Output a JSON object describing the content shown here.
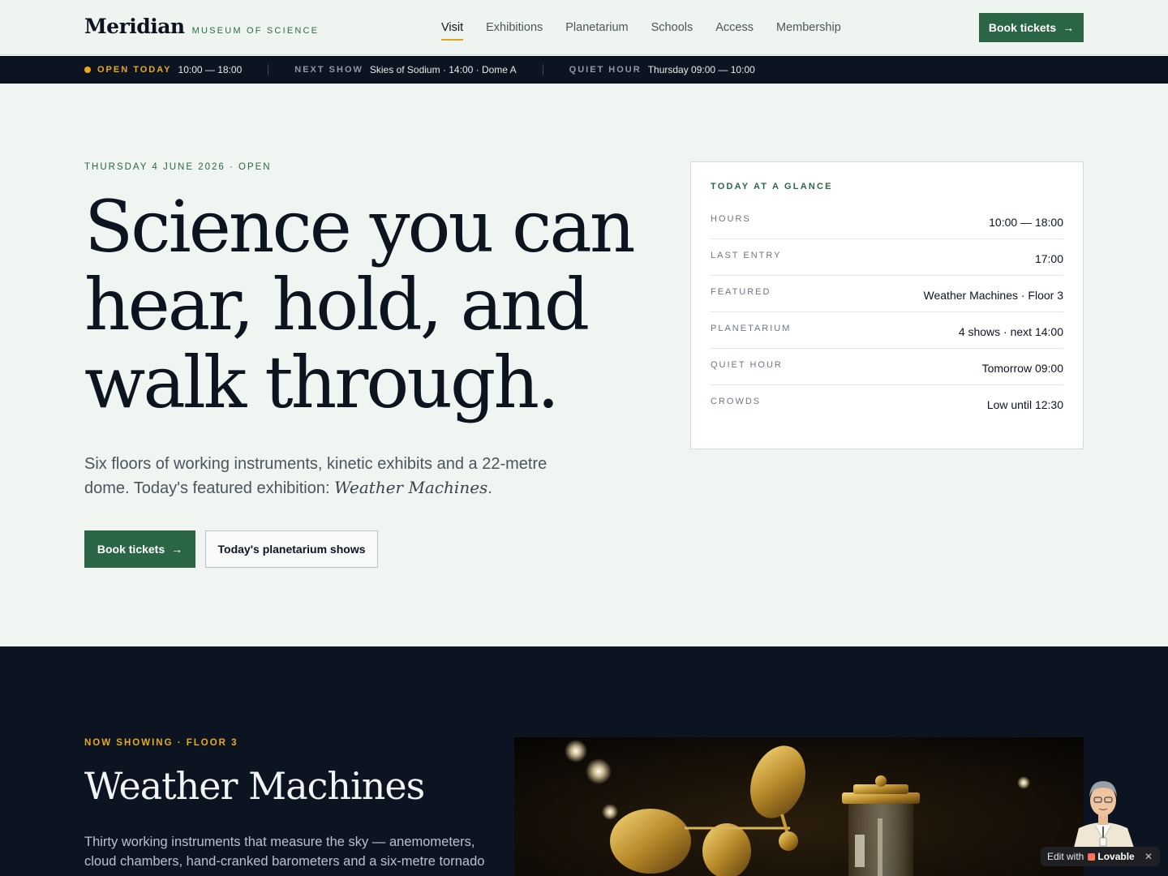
{
  "header": {
    "brand_name": "Meridian",
    "brand_sub": "MUSEUM OF SCIENCE",
    "nav": [
      "Visit",
      "Exhibitions",
      "Planetarium",
      "Schools",
      "Access",
      "Membership"
    ],
    "active_nav": "Visit",
    "cta_label": "Book tickets",
    "cta_arrow": "→"
  },
  "status": {
    "open_label": "OPEN TODAY",
    "open_value": "10:00 — 18:00",
    "show_label": "NEXT SHOW",
    "show_value": "Skies of Sodium · 14:00 · Dome A",
    "quiet_label": "QUIET HOUR",
    "quiet_value": "Thursday 09:00 — 10:00"
  },
  "hero": {
    "eyebrow": "THURSDAY 4 JUNE 2026 · OPEN",
    "title": "Science you can hear, hold, and walk through.",
    "lede_prefix": "Six floors of working instruments, kinetic exhibits and a 22-metre dome. Today's featured exhibition: ",
    "lede_em": "Weather Machines",
    "lede_suffix": ".",
    "primary_label": "Book tickets",
    "primary_arrow": "→",
    "secondary_label": "Today's planetarium shows"
  },
  "glance": {
    "title": "TODAY AT A GLANCE",
    "rows": [
      {
        "key": "HOURS",
        "value": "10:00 — 18:00"
      },
      {
        "key": "LAST ENTRY",
        "value": "17:00"
      },
      {
        "key": "FEATURED",
        "value": "Weather Machines · Floor 3"
      },
      {
        "key": "PLANETARIUM",
        "value": "4 shows · next 14:00"
      },
      {
        "key": "QUIET HOUR",
        "value": "Tomorrow 09:00"
      },
      {
        "key": "CROWDS",
        "value": "Low until 12:30"
      }
    ]
  },
  "now_showing": {
    "eyebrow": "NOW SHOWING · FLOOR 3",
    "title": "Weather Machines",
    "description": "Thirty working instruments that measure the sky — anemometers, cloud chambers, hand-cranked barometers and a six-metre tornado"
  },
  "badge": {
    "edit_with": "Edit with",
    "brand": "Lovable",
    "close": "✕"
  },
  "colors": {
    "accent_green": "#2a6645",
    "accent_gold": "#e8a91c",
    "ink": "#0c1420"
  }
}
